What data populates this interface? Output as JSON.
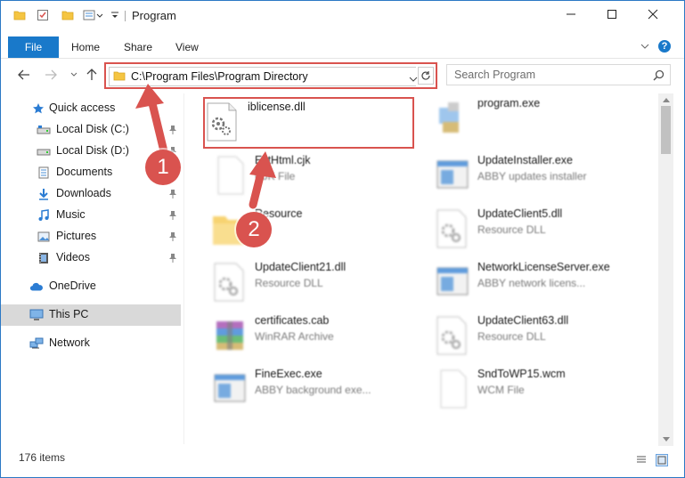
{
  "window": {
    "title": "Program",
    "colors": {
      "accent": "#1979ca",
      "annotation": "#d9534f"
    }
  },
  "ribbon": {
    "file_tab": "File",
    "tabs": [
      "Home",
      "Share",
      "View"
    ],
    "help_label": "?"
  },
  "navigation": {
    "address": "C:\\Program Files\\Program Directory",
    "search_placeholder": "Search Program"
  },
  "sidebar": {
    "quick_access": "Quick access",
    "items": [
      {
        "label": "Local Disk (C:)",
        "icon": "drive-icon",
        "pinned": true
      },
      {
        "label": "Local Disk (D:)",
        "icon": "drive-icon",
        "pinned": true
      },
      {
        "label": "Documents",
        "icon": "documents-icon",
        "pinned": true
      },
      {
        "label": "Downloads",
        "icon": "downloads-icon",
        "pinned": true
      },
      {
        "label": "Music",
        "icon": "music-icon",
        "pinned": true
      },
      {
        "label": "Pictures",
        "icon": "pictures-icon",
        "pinned": true
      },
      {
        "label": "Videos",
        "icon": "videos-icon",
        "pinned": true
      }
    ],
    "onedrive": "OneDrive",
    "this_pc": "This PC",
    "network": "Network"
  },
  "files": [
    {
      "name": "iblicense.dll",
      "desc": "",
      "icon": "dll-icon"
    },
    {
      "name": "program.exe",
      "desc": "",
      "icon": "exe-icon"
    },
    {
      "name": "ExtHtml.cjk",
      "desc": "CJK File",
      "icon": "blank-file-icon"
    },
    {
      "name": "UpdateInstaller.exe",
      "desc": "ABBY updates installer",
      "icon": "app-window-icon"
    },
    {
      "name": "Resource",
      "desc": "",
      "icon": "folder-icon"
    },
    {
      "name": "UpdateClient5.dll",
      "desc": "Resource DLL",
      "icon": "dll-icon"
    },
    {
      "name": "UpdateClient21.dll",
      "desc": "Resource DLL",
      "icon": "dll-icon"
    },
    {
      "name": "NetworkLicenseServer.exe",
      "desc": "ABBY network licens...",
      "icon": "app-window-icon"
    },
    {
      "name": "certificates.cab",
      "desc": "WinRAR Archive",
      "icon": "archive-icon"
    },
    {
      "name": "UpdateClient63.dll",
      "desc": "Resource DLL",
      "icon": "dll-icon"
    },
    {
      "name": "FineExec.exe",
      "desc": "ABBY background exe...",
      "icon": "app-window-icon"
    },
    {
      "name": "SndToWP15.wcm",
      "desc": "WCM File",
      "icon": "blank-file-icon"
    }
  ],
  "status": {
    "item_count": "176 items"
  },
  "annotations": {
    "step1": "1",
    "step2": "2"
  }
}
